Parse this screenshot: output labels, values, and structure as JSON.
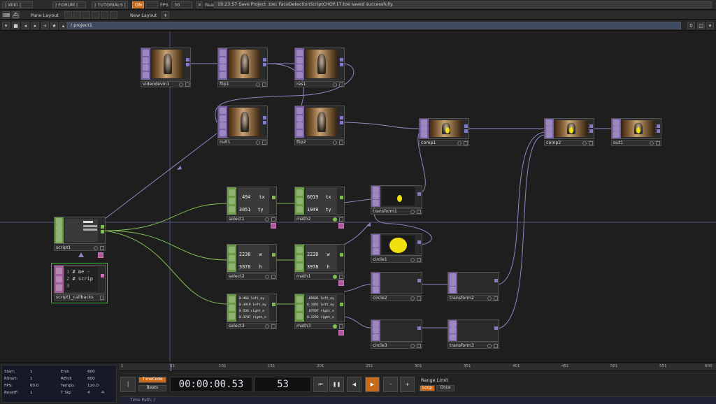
{
  "topbar": {
    "wiki": "| WIKI |",
    "forum": "| FORUM |",
    "tutorials": "| TUTORIALS |",
    "on": "ON",
    "fps_label": "FPS",
    "fps_value": "30",
    "realtime": "Realtime",
    "message": "19:23:57 Save Project .toe: FaceDetectionScriptCHOP.17.toe saved successfully."
  },
  "bar2": {
    "pane_layout": "Pane Layout",
    "new_layout": "New Layout",
    "plus": "+"
  },
  "bar3": {
    "path": "/ project1",
    "zero": "0"
  },
  "nodes": {
    "videodevin1": "videodevin1",
    "flip1": "flip1",
    "res1": "res1",
    "null1": "null1",
    "flip2": "flip2",
    "comp1": "comp1",
    "comp2": "comp2",
    "out1": "out1",
    "select1": "select1",
    "math2": "math2",
    "transform1": "transform1",
    "circle1": "circle1",
    "script1": "script1",
    "script1_callbacks": "script1_callbacks",
    "select2": "select2",
    "math1": "math1",
    "circle2": "circle2",
    "transform2": "transform2",
    "select3": "select3",
    "math3": "math3",
    "circle3": "circle3",
    "transform3": "transform3"
  },
  "channels": {
    "select1": {
      "v1": ".494",
      "n1": "tx",
      "v2": "3051",
      "n2": "ty"
    },
    "math2": {
      "v1": "6019",
      "n1": "tx",
      "v2": "1949",
      "n2": "ty"
    },
    "select2": {
      "v1": "2238",
      "n1": "w",
      "v2": "3978",
      "n2": "h"
    },
    "math1": {
      "v1": "2238",
      "n1": "w",
      "v2": "3978",
      "n2": "h"
    },
    "select3": [
      {
        "v": "0.466",
        "n": "left_ey"
      },
      {
        "v": "0.3919",
        "n": "left_ey"
      },
      {
        "v": "0.536",
        "n": "right_e"
      },
      {
        "v": "0.3707",
        "n": "right_e"
      }
    ],
    "math3": [
      {
        "v": ".05601",
        "n": "left_ey"
      },
      {
        "v": "0.1081",
        "n": "left_ey"
      },
      {
        "v": ".07597",
        "n": "right_e"
      },
      {
        "v": "0.1293",
        "n": "right_e"
      }
    ]
  },
  "script_code": {
    "l1": "1",
    "t1": "# me -",
    "l2": "2",
    "t2": "# scrip",
    "l3": "3",
    "t3": ""
  },
  "info": {
    "start_label": "Start:",
    "start": "1",
    "end_label": "End:",
    "end": "600",
    "rstart_label": "RStart:",
    "rstart": "1",
    "rend_label": "REnd:",
    "rend": "600",
    "fps_label": "FPS:",
    "fps": "60.0",
    "tempo_label": "Tempo:",
    "tempo": "120.0",
    "resetf_label": "ResetF:",
    "resetf": "1",
    "tsig_label": "T Sig:",
    "tsig_a": "4",
    "tsig_b": "4"
  },
  "ruler": {
    "ticks": [
      "1",
      "51",
      "101",
      "151",
      "201",
      "251",
      "301",
      "351",
      "401",
      "451",
      "501",
      "551",
      "600"
    ]
  },
  "transport": {
    "timecode_btn": "TimeCode",
    "beats_btn": "Beats",
    "timecode": "00:00:00.53",
    "frame": "53",
    "range_limit": "Range Limit",
    "loop": "Loop",
    "once": "Once",
    "time_path": "Time Path: /"
  },
  "colors": {
    "accent": "#c86a1a",
    "top_op": "#7b5fa8",
    "chop_op": "#6a9a45",
    "dat_op": "#a0609a",
    "selected": "#30c030"
  }
}
